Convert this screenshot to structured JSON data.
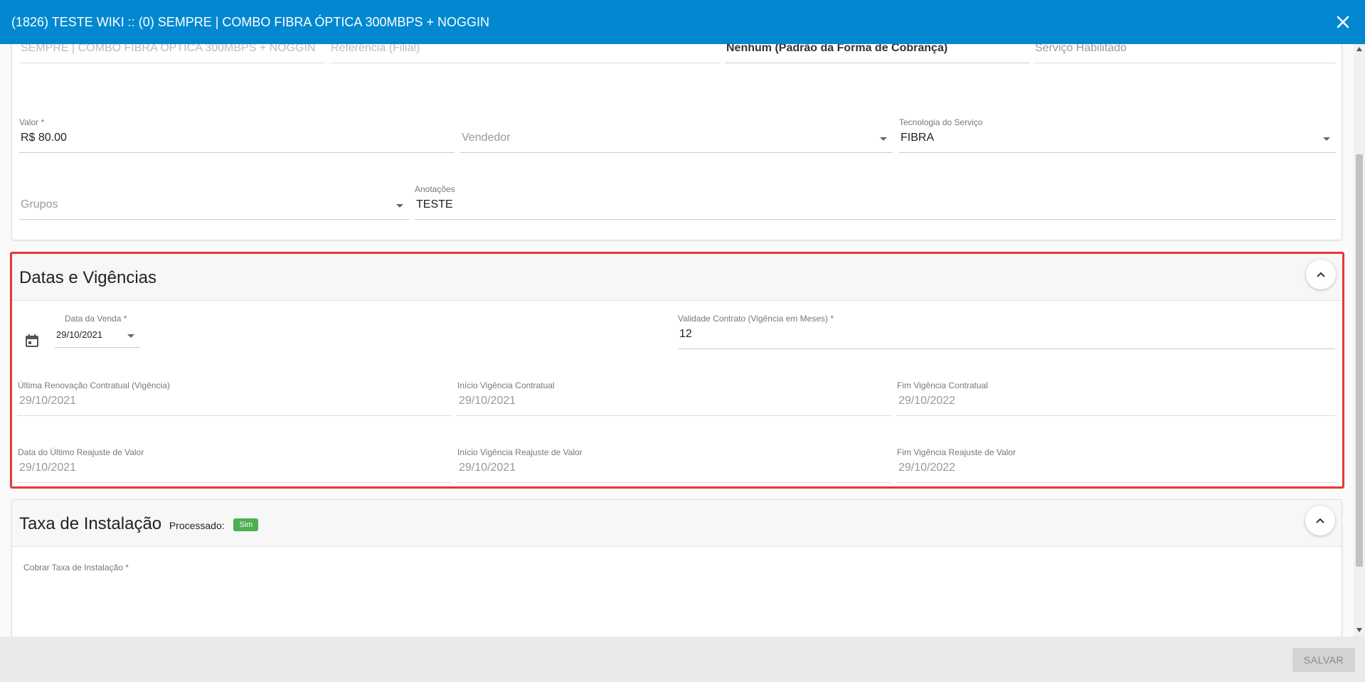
{
  "window": {
    "title": "(1826) TESTE WIKI :: (0) SEMPRE | COMBO FIBRA ÓPTICA 300MBPS + NOGGIN",
    "close_label": "✕"
  },
  "general": {
    "top_row": [
      "SEMPRE | COMBO FIBRA ÓPTICA 300MBPS + NOGGIN",
      "Referência (Filial)",
      "Nenhum (Padrão da Forma de Cobrança)",
      "Serviço Habilitado"
    ],
    "valor": {
      "label": "Valor *",
      "value": "R$ 80.00"
    },
    "vendedor": {
      "placeholder": "Vendedor"
    },
    "tecnologia": {
      "label": "Tecnologia do Serviço",
      "value": "FIBRA"
    },
    "grupos": {
      "placeholder": "Grupos"
    },
    "anotacoes": {
      "label": "Anotações",
      "value": "TESTE"
    }
  },
  "datas": {
    "title": "Datas e Vigências",
    "data_venda": {
      "label": "Data da Venda *",
      "value": "29/10/2021"
    },
    "validade": {
      "label": "Validade Contrato (Vigência em Meses) *",
      "value": "12"
    },
    "ultima_renovacao": {
      "label": "Última Renovação Contratual (Vigência)",
      "value": "29/10/2021"
    },
    "inicio_vigencia": {
      "label": "Início Vigência Contratual",
      "value": "29/10/2021"
    },
    "fim_vigencia": {
      "label": "Fim Vigência Contratual",
      "value": "29/10/2022"
    },
    "ultimo_reajuste": {
      "label": "Data do Último Reajuste de Valor",
      "value": "29/10/2021"
    },
    "inicio_reajuste": {
      "label": "Início Vigência Reajuste de Valor",
      "value": "29/10/2021"
    },
    "fim_reajuste": {
      "label": "Fim Vigência Reajuste de Valor",
      "value": "29/10/2022"
    }
  },
  "taxa": {
    "title": "Taxa de Instalação",
    "processado_label": "Processado:",
    "processado_badge": "Sim",
    "cobrar_label": "Cobrar Taxa de Instalação *"
  },
  "footer": {
    "save_label": "SALVAR"
  },
  "colors": {
    "header_blue": "#0288d1",
    "highlight_red": "#e53935",
    "badge_green": "#4caf50"
  },
  "icons": [
    "close-icon",
    "chevron-up-icon",
    "calendar-icon",
    "dropdown-caret-icon"
  ]
}
